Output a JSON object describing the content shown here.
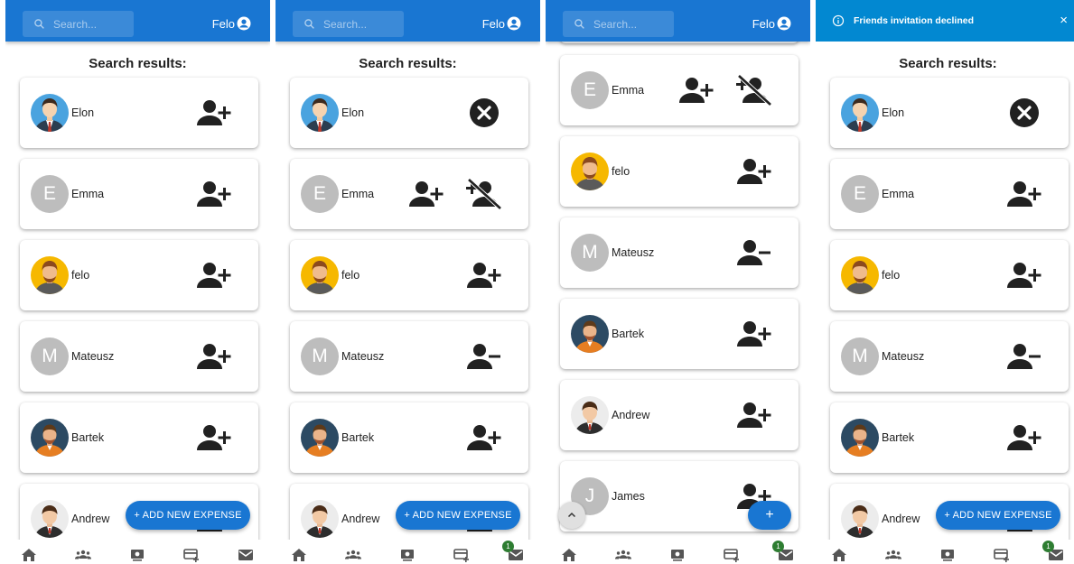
{
  "colors": {
    "primary": "#1976d2",
    "snackbar_info": "#0288d1",
    "avatar_letter_bg": "#bdbdbd",
    "badge": "#2e7d32"
  },
  "header": {
    "search_placeholder": "Search...",
    "username": "Felo"
  },
  "section_title": "Search results:",
  "snackbar": {
    "message": "Friends invitation declined",
    "close_label": "×"
  },
  "fab": {
    "add_expense_label": "+ ADD NEW EXPENSE",
    "add_label": "+"
  },
  "bottom_nav": {
    "items": [
      "home-icon",
      "group-icon",
      "money-icon",
      "card-add-icon",
      "mail-icon"
    ],
    "mail_badge": "1"
  },
  "screens": [
    {
      "users": [
        {
          "name": "Elon",
          "avatar": "elon",
          "actions": [
            "person-add-icon"
          ]
        },
        {
          "name": "Emma",
          "avatar": "letter",
          "letter": "E",
          "actions": [
            "person-add-icon"
          ]
        },
        {
          "name": "felo",
          "avatar": "felo",
          "actions": [
            "person-add-icon"
          ]
        },
        {
          "name": "Mateusz",
          "avatar": "letter",
          "letter": "M",
          "actions": [
            "person-add-icon"
          ]
        },
        {
          "name": "Bartek",
          "avatar": "bartek",
          "actions": [
            "person-add-icon"
          ]
        },
        {
          "name": "Andrew",
          "avatar": "andrew",
          "actions": [
            "person-add-icon"
          ]
        }
      ]
    },
    {
      "users": [
        {
          "name": "Elon",
          "avatar": "elon",
          "actions": [
            "cancel-icon"
          ]
        },
        {
          "name": "Emma",
          "avatar": "letter",
          "letter": "E",
          "actions": [
            "person-add-icon",
            "person-add-disabled-icon"
          ]
        },
        {
          "name": "felo",
          "avatar": "felo",
          "actions": [
            "person-add-icon"
          ]
        },
        {
          "name": "Mateusz",
          "avatar": "letter",
          "letter": "M",
          "actions": [
            "person-remove-icon"
          ]
        },
        {
          "name": "Bartek",
          "avatar": "bartek",
          "actions": [
            "person-add-icon"
          ]
        },
        {
          "name": "Andrew",
          "avatar": "andrew",
          "actions": [
            "person-add-icon"
          ]
        }
      ]
    },
    {
      "users": [
        {
          "name": "Emma",
          "avatar": "letter",
          "letter": "E",
          "actions": [
            "person-add-icon",
            "person-add-disabled-icon"
          ]
        },
        {
          "name": "felo",
          "avatar": "felo",
          "actions": [
            "person-add-icon"
          ]
        },
        {
          "name": "Mateusz",
          "avatar": "letter",
          "letter": "M",
          "actions": [
            "person-remove-icon"
          ]
        },
        {
          "name": "Bartek",
          "avatar": "bartek",
          "actions": [
            "person-add-icon"
          ]
        },
        {
          "name": "Andrew",
          "avatar": "andrew",
          "actions": [
            "person-add-icon"
          ]
        },
        {
          "name": "James",
          "avatar": "letter",
          "letter": "J",
          "actions": [
            "person-add-icon"
          ]
        }
      ]
    },
    {
      "users": [
        {
          "name": "Elon",
          "avatar": "elon",
          "actions": [
            "cancel-icon"
          ]
        },
        {
          "name": "Emma",
          "avatar": "letter",
          "letter": "E",
          "actions": [
            "person-add-icon"
          ]
        },
        {
          "name": "felo",
          "avatar": "felo",
          "actions": [
            "person-add-icon"
          ]
        },
        {
          "name": "Mateusz",
          "avatar": "letter",
          "letter": "M",
          "actions": [
            "person-remove-icon"
          ]
        },
        {
          "name": "Bartek",
          "avatar": "bartek",
          "actions": [
            "person-add-icon"
          ]
        },
        {
          "name": "Andrew",
          "avatar": "andrew",
          "actions": [
            "person-add-icon"
          ]
        }
      ]
    }
  ]
}
